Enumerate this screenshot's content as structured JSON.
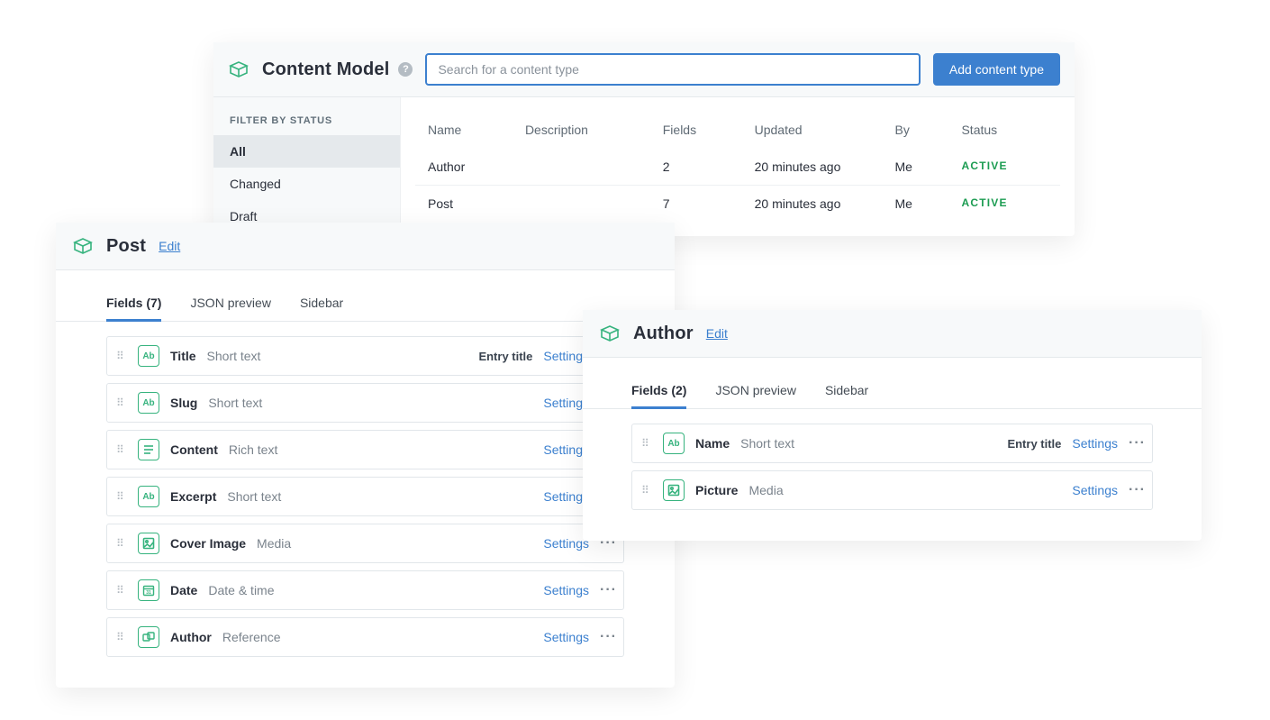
{
  "main": {
    "title": "Content Model",
    "search_placeholder": "Search for a content type",
    "add_button": "Add content type",
    "filter_title": "FILTER BY STATUS",
    "filters": [
      {
        "label": "All",
        "active": true
      },
      {
        "label": "Changed",
        "active": false
      },
      {
        "label": "Draft",
        "active": false
      }
    ],
    "columns": [
      "Name",
      "Description",
      "Fields",
      "Updated",
      "By",
      "Status"
    ],
    "rows": [
      {
        "name": "Author",
        "description": "",
        "fields": "2",
        "updated": "20 minutes ago",
        "by": "Me",
        "status": "ACTIVE"
      },
      {
        "name": "Post",
        "description": "",
        "fields": "7",
        "updated": "20 minutes ago",
        "by": "Me",
        "status": "ACTIVE"
      }
    ]
  },
  "common": {
    "edit": "Edit",
    "settings": "Settings",
    "entry_title": "Entry title",
    "tabs_json": "JSON preview",
    "tabs_sidebar": "Sidebar"
  },
  "post": {
    "title": "Post",
    "tab_fields": "Fields (7)",
    "fields": [
      {
        "name": "Title",
        "type": "Short text",
        "icon": "text",
        "entry_title": true
      },
      {
        "name": "Slug",
        "type": "Short text",
        "icon": "text",
        "entry_title": false
      },
      {
        "name": "Content",
        "type": "Rich text",
        "icon": "rich",
        "entry_title": false
      },
      {
        "name": "Excerpt",
        "type": "Short text",
        "icon": "text",
        "entry_title": false
      },
      {
        "name": "Cover Image",
        "type": "Media",
        "icon": "media",
        "entry_title": false
      },
      {
        "name": "Date",
        "type": "Date & time",
        "icon": "date",
        "entry_title": false
      },
      {
        "name": "Author",
        "type": "Reference",
        "icon": "ref",
        "entry_title": false
      }
    ]
  },
  "author": {
    "title": "Author",
    "tab_fields": "Fields (2)",
    "fields": [
      {
        "name": "Name",
        "type": "Short text",
        "icon": "text",
        "entry_title": true
      },
      {
        "name": "Picture",
        "type": "Media",
        "icon": "media",
        "entry_title": false
      }
    ]
  }
}
